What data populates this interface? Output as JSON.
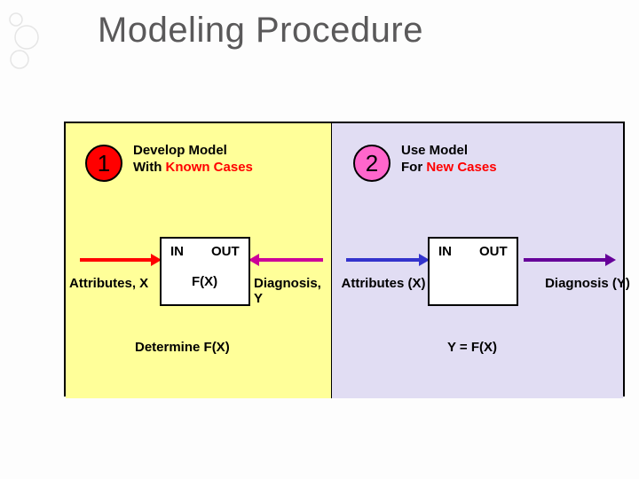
{
  "title": "Modeling Procedure",
  "steps": {
    "one": {
      "num": "1",
      "line1": "Develop Model",
      "line2a": "With ",
      "line2b": "Known Cases"
    },
    "two": {
      "num": "2",
      "line1": "Use Model",
      "line2a": "For ",
      "line2b": "New Cases"
    }
  },
  "box": {
    "in": "IN",
    "out": "OUT",
    "fx": "F(X)"
  },
  "labels": {
    "attributesX": "Attributes, X",
    "diagnosisY": "Diagnosis, Y",
    "attributesXparen": "Attributes (X)",
    "diagnosisYparen": "Diagnosis (Y)"
  },
  "footer": {
    "left": "Determine F(X)",
    "right": "Y = F(X)"
  }
}
